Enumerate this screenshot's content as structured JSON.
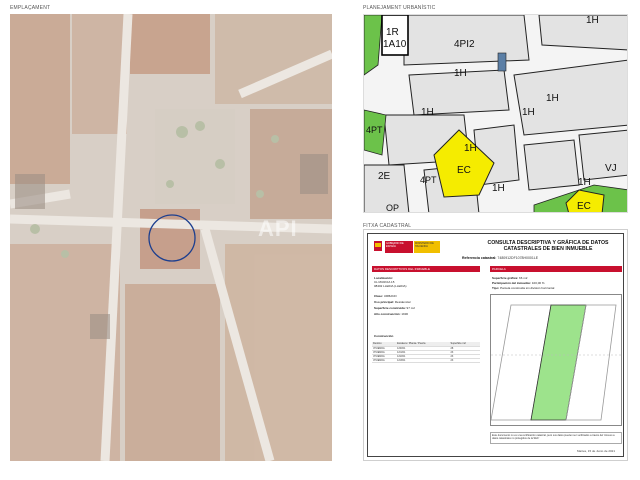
{
  "labels": {
    "emplacement": "EMPLAÇAMENT",
    "planning": "PLANEJAMENT URBANÍSTIC",
    "cadastral": "FITXA CADASTRAL"
  },
  "planning_zones": {
    "z1": "1H",
    "z2": "4PI2",
    "z3": "1H",
    "z4": "1H",
    "z5": "1H",
    "z6": "1H",
    "z7": "EC",
    "z8": "1H",
    "z9": "2E",
    "z10": "4PT",
    "z11": "1H",
    "z12": "EC",
    "z13": "1H",
    "z14": "1R",
    "z15": "1A10",
    "z16": "4PT",
    "z17": "VJ",
    "z18": "OP"
  },
  "cadastral": {
    "ministry_a": "GOBIERNO DE ESPAÑA",
    "ministry_b": "MINISTERIO DE HACIENDA",
    "title": "CONSULTA DESCRIPTIVA Y GRÁFICA DE DATOS CATASTRALES DE BIEN INMUEBLE",
    "ref_label": "Referencia catastral:",
    "ref_value": "7480912DF1078H0001LE",
    "section1": "DATOS DESCRIPTIVOS DEL INMUEBLE",
    "section2": "PARCELA",
    "loc_label": "Localización:",
    "loc_value": "CL MURCIA 15",
    "loc_value2": "08402 LLEIDA (LLEIDA)",
    "class_label": "Clase:",
    "class_value": "URBANO",
    "use_label": "Uso principal:",
    "use_value": "Residencial",
    "area_label": "Superficie construida:",
    "area_value": "97 m2",
    "year_label": "Año construcción:",
    "year_value": "1930",
    "construction": "Construcción",
    "parcel_area_label": "Superficie gráfica:",
    "parcel_area_value": "66 m2",
    "share_label": "Participación del inmueble:",
    "share_value": "100,00 %",
    "type_label": "Tipo:",
    "type_value": "Parcela construida sin división horizontal",
    "table_headers": [
      "Destino",
      "Escalera / Planta / Puerta",
      "Superficie m2"
    ],
    "table_rows": [
      [
        "VIVIENDA",
        "1/00/01",
        "28"
      ],
      [
        "VIVIENDA",
        "1/01/01",
        "23"
      ],
      [
        "VIVIENDA",
        "1/02/01",
        "23"
      ],
      [
        "VIVIENDA",
        "1/03/01",
        "23"
      ]
    ],
    "footer_note": "Este documento no es una certificación catastral, pero sus datos pueden ser verificados a través del 'Acceso a datos catastrales no protegidos de la SEC'",
    "date": "Martes, 15 de Junio de 2021"
  },
  "watermark": "API"
}
